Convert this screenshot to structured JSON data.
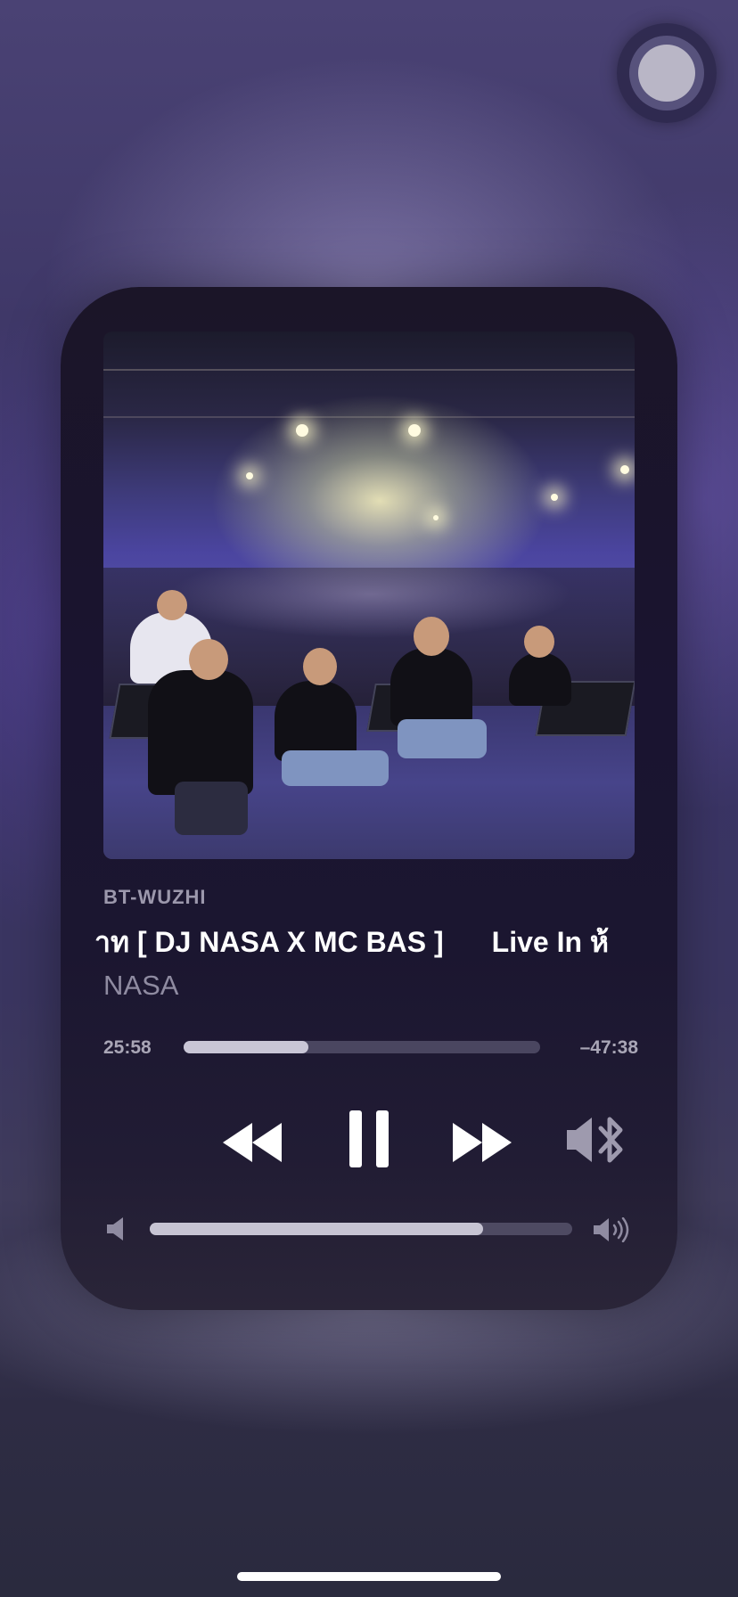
{
  "player": {
    "source": "BT-WUZHI",
    "title": "าท [ DJ NASA X MC BAS ]",
    "title_next": "Live In ห้",
    "artist": "NASA",
    "elapsed": "25:58",
    "remaining": "–47:38",
    "progress_fraction": 0.35,
    "volume_fraction": 0.79,
    "is_playing": true
  },
  "icons": {
    "rewind": "rewind-icon",
    "pause": "pause-icon",
    "forward": "fast-forward-icon",
    "output": "bluetooth-speaker-icon",
    "volume_low": "volume-low-icon",
    "volume_high": "volume-high-icon"
  },
  "colors": {
    "background": "#3a3466",
    "card": "#1b1628",
    "text_primary": "#ffffff",
    "text_secondary": "#8f8ba1",
    "track_fill": "#c9c6d6",
    "track_empty": "#4a4660"
  }
}
